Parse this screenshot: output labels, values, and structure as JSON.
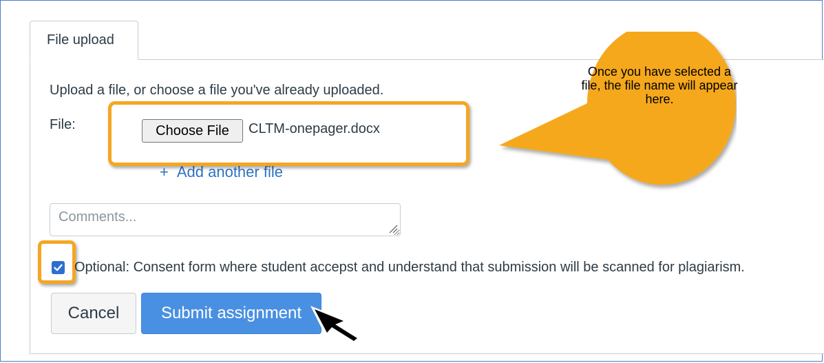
{
  "tab": {
    "label": "File upload"
  },
  "upload": {
    "instructions": "Upload a file, or choose a file you've already uploaded.",
    "file_label": "File:",
    "choose_button": "Choose File",
    "file_name": "CLTM-onepager.docx",
    "add_another": "Add another file",
    "add_icon": "+"
  },
  "comments": {
    "placeholder": "Comments...",
    "value": ""
  },
  "consent": {
    "checked": true,
    "label": "Optional: Consent form where student accepst and understand that submission will be scanned for plagiarism."
  },
  "actions": {
    "cancel": "Cancel",
    "submit": "Submit assignment"
  },
  "callout": {
    "text": "Once you have selected a file, the file name will appear here."
  },
  "colors": {
    "accent": "#f5a623",
    "submit": "#4a90e2",
    "link": "#2d73c4",
    "checkbox": "#2c6fd1"
  },
  "icons": {
    "cursor": "arrow-cursor-icon",
    "resize": "resize-grip-icon",
    "check": "checkmark-icon"
  }
}
